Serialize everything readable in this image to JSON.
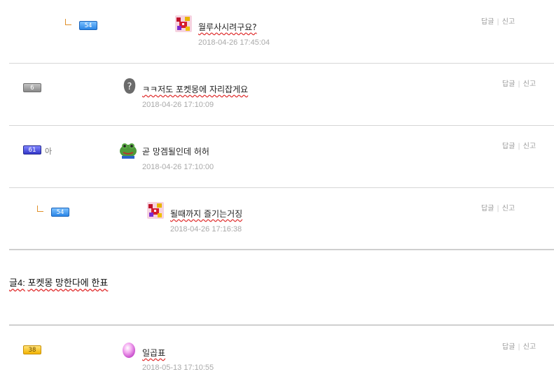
{
  "comments": [
    {
      "level": "54",
      "text": "월루사시려구요?",
      "date": "2018-04-26 17:45:04",
      "reply_label": "답글",
      "report_label": "신고"
    },
    {
      "level": "6",
      "text": "ㅋㅋ저도 포켓몽에 자리잡게요",
      "date": "2018-04-26 17:10:09",
      "reply_label": "답글",
      "report_label": "신고"
    },
    {
      "level": "61",
      "nick_extra": "아",
      "text": "곧 망겜될인데 허허",
      "date": "2018-04-26 17:10:00",
      "reply_label": "답글",
      "report_label": "신고"
    },
    {
      "level": "54",
      "text": "될때까지 즐기는거징",
      "date": "2018-04-26 17:16:38",
      "reply_label": "답글",
      "report_label": "신고"
    },
    {
      "level": "38",
      "text": "일곱표",
      "date": "2018-05-13 17:10:55",
      "reply_label": "답글",
      "report_label": "신고"
    }
  ],
  "post": {
    "label": "글4:",
    "title": "포켓몽 망한다에 한표"
  },
  "icons": {
    "reply_marker": "reply-arrow-icon",
    "avatar_unknown": "question-mark-icon",
    "avatar_frog": "frog-icon",
    "avatar_egg": "egg-icon",
    "avatar_pixel": "pixel-character-icon"
  },
  "colors": {
    "level_blue": "#2a86e6",
    "level_gray": "#8a8a8a",
    "level_indigo": "#3438c9",
    "level_gold": "#f2b400",
    "date_gray": "#a9a9a9",
    "spell_underline": "#e03030"
  }
}
